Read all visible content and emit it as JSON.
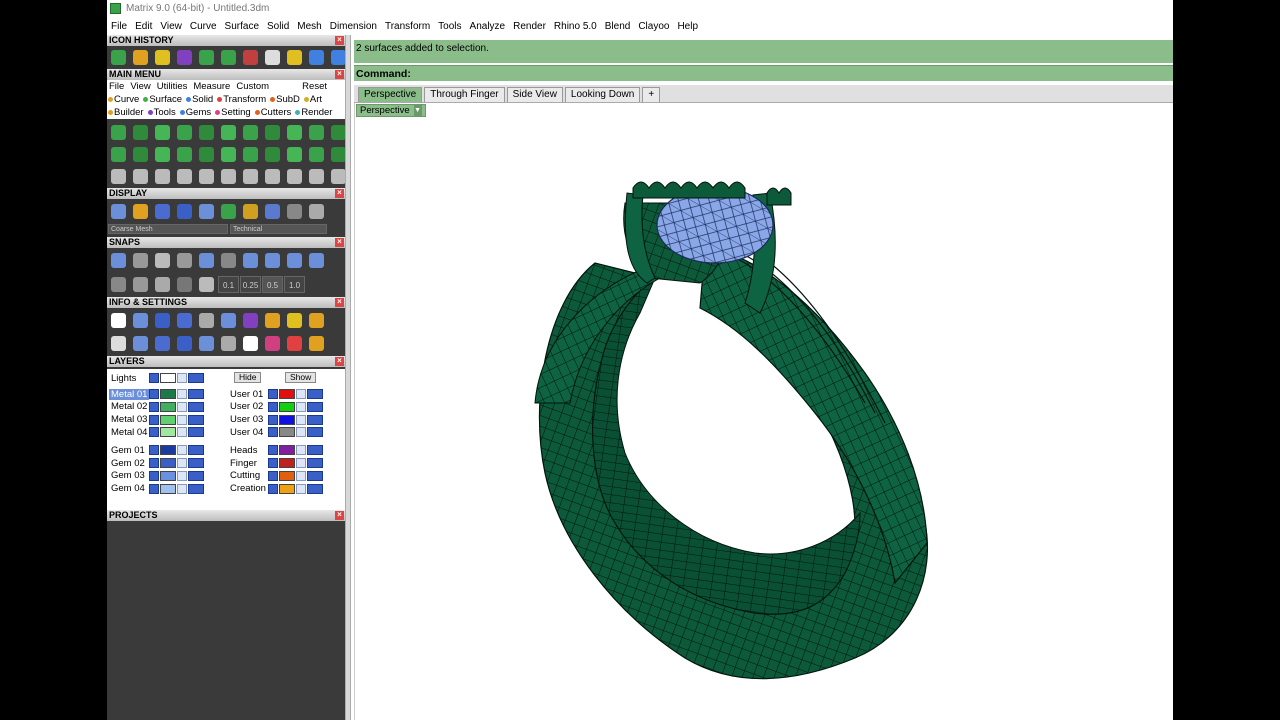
{
  "window": {
    "title": "Matrix 9.0 (64-bit) - Untitled.3dm"
  },
  "menubar": [
    "File",
    "Edit",
    "View",
    "Curve",
    "Surface",
    "Solid",
    "Mesh",
    "Dimension",
    "Transform",
    "Tools",
    "Analyze",
    "Render",
    "Rhino 5.0",
    "Blend",
    "Clayoo",
    "Help"
  ],
  "sections": {
    "icon_history": "ICON HISTORY",
    "main_menu": "MAIN MENU",
    "display": "DISPLAY",
    "snaps": "SNAPS",
    "info_settings": "INFO & SETTINGS",
    "layers": "LAYERS",
    "projects": "PROJECTS"
  },
  "main_menu": {
    "items": [
      "File",
      "View",
      "Utilities",
      "Measure",
      "Custom"
    ],
    "reset": "Reset",
    "categories_row1": [
      {
        "label": "Curve",
        "color": "#e0a020"
      },
      {
        "label": "Surface",
        "color": "#40b040"
      },
      {
        "label": "Solid",
        "color": "#4080e0"
      },
      {
        "label": "Transform",
        "color": "#e04040"
      },
      {
        "label": "SubD",
        "color": "#e06020"
      },
      {
        "label": "Art",
        "color": "#d0b020"
      }
    ],
    "categories_row2": [
      {
        "label": "Builder",
        "color": "#e0a020"
      },
      {
        "label": "Tools",
        "color": "#8040c0"
      },
      {
        "label": "Gems",
        "color": "#4080e0"
      },
      {
        "label": "Setting",
        "color": "#e04080"
      },
      {
        "label": "Cutters",
        "color": "#e06020"
      },
      {
        "label": "Render",
        "color": "#40b0b0"
      }
    ]
  },
  "display": {
    "mesh_quality": "Coarse Mesh",
    "render_mode": "Technical"
  },
  "snaps": {
    "values": [
      "0.1",
      "0.25",
      "0.5",
      "1.0"
    ]
  },
  "layers": {
    "lights": "Lights",
    "hide": "Hide",
    "show": "Show",
    "left": [
      {
        "name": "Metal 01",
        "color": "#1a7a4a",
        "selected": true
      },
      {
        "name": "Metal 02",
        "color": "#40b060",
        "selected": false
      },
      {
        "name": "Metal 03",
        "color": "#60d070",
        "selected": false
      },
      {
        "name": "Metal 04",
        "color": "#a0e8a0",
        "selected": false
      },
      {
        "name": "Gem 01",
        "color": "#1a3aa0",
        "selected": false
      },
      {
        "name": "Gem 02",
        "color": "#3a60c8",
        "selected": false
      },
      {
        "name": "Gem 03",
        "color": "#6a90e0",
        "selected": false
      },
      {
        "name": "Gem 04",
        "color": "#a0c0f0",
        "selected": false
      }
    ],
    "right": [
      {
        "name": "User 01",
        "color": "#e01010"
      },
      {
        "name": "User 02",
        "color": "#10d010"
      },
      {
        "name": "User 03",
        "color": "#1010e0"
      },
      {
        "name": "User 04",
        "color": "#888888"
      },
      {
        "name": "Heads",
        "color": "#8020a0"
      },
      {
        "name": "Finger",
        "color": "#c02020"
      },
      {
        "name": "Cutting",
        "color": "#e06010"
      },
      {
        "name": "Creation",
        "color": "#f0a010"
      }
    ]
  },
  "command": {
    "history": "2 surfaces added to selection.",
    "prompt": "Command:"
  },
  "tabs": [
    "Perspective",
    "Through Finger",
    "Side View",
    "Looking Down"
  ],
  "viewport": {
    "label": "Perspective"
  },
  "colors": {
    "ring_green": "#0c5a3a",
    "ring_edge": "#02140d",
    "gem_blue": "#7c9ee0",
    "command_bg": "#8bbd8b"
  },
  "icons": {
    "history": [
      "curve-icon",
      "box-icon",
      "circle-icon",
      "cube-icon",
      "bend-icon",
      "grid-icon",
      "house-icon",
      "cursor-icon",
      "arc-icon",
      "arrow-left-icon",
      "arrow-right-icon"
    ]
  }
}
